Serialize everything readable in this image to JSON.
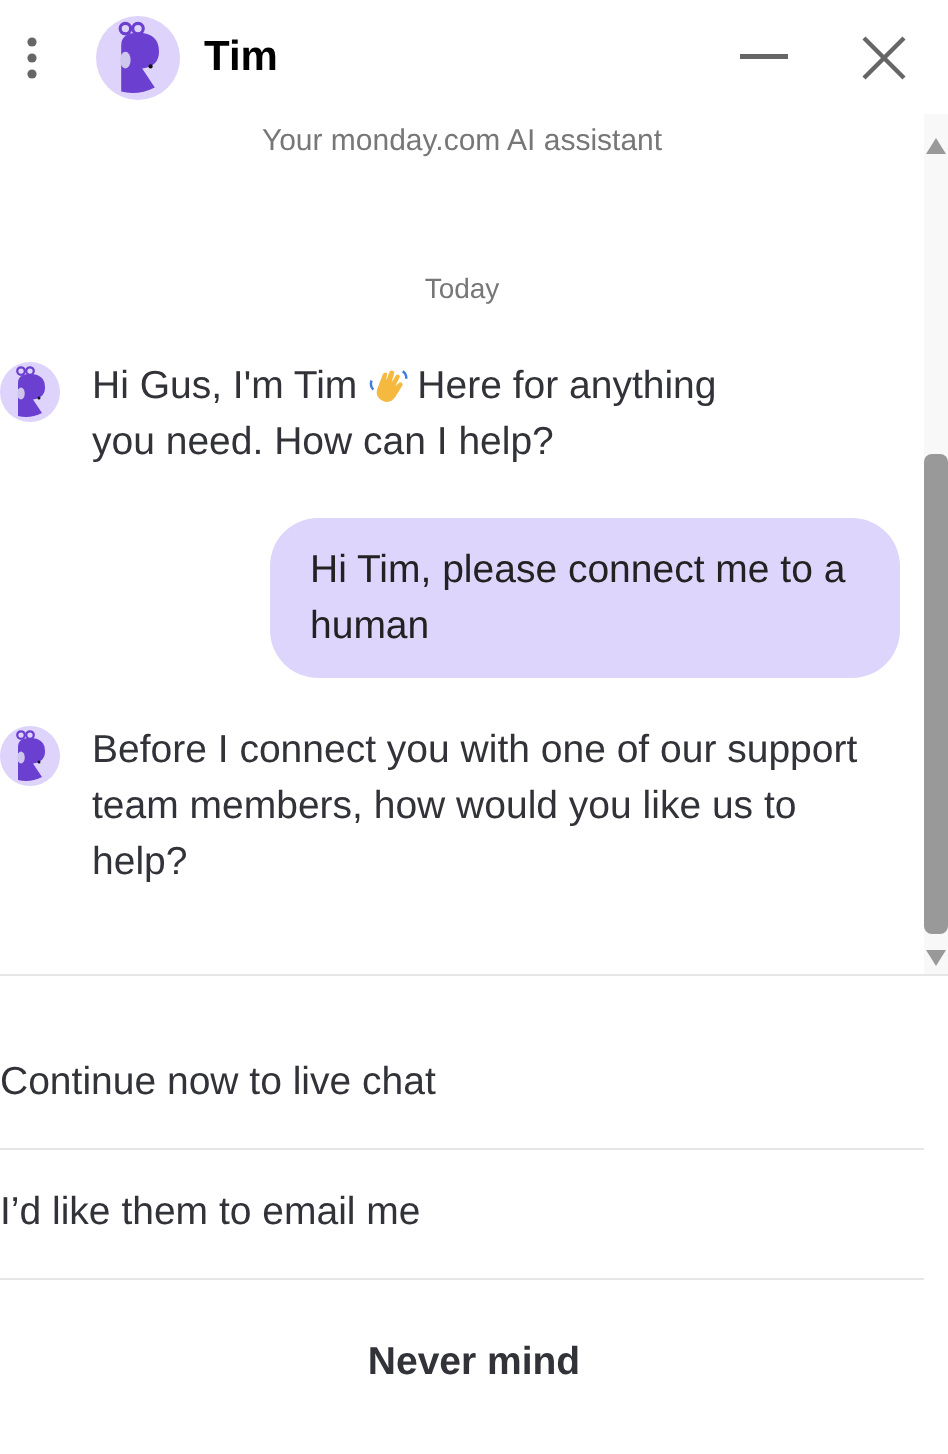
{
  "header": {
    "title": "Tim"
  },
  "chat": {
    "subtitle": "Your monday.com AI assistant",
    "date_divider": "Today",
    "messages": [
      {
        "kind": "bot",
        "text_before": "Hi Gus, I'm Tim",
        "wave": true,
        "text_after": "Here for anything",
        "text_next": "you need. How can I help?"
      },
      {
        "kind": "user",
        "text_before": "Hi Tim, please connect me to a human"
      },
      {
        "kind": "bot",
        "text_before": "Before I connect you with one of our support team members, how would you like us to help?",
        "wave": false
      }
    ]
  },
  "options": [
    {
      "label": "Continue now to live chat",
      "kind": "option"
    },
    {
      "label": "I’d like them to email me",
      "kind": "option"
    },
    {
      "label": "Never mind",
      "kind": "cancel"
    }
  ]
}
